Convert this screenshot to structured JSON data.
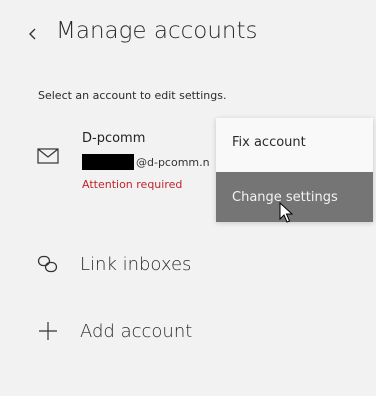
{
  "header": {
    "title": "Manage accounts",
    "back_icon": "chevron-left-icon"
  },
  "subtitle": "Select an account to edit settings.",
  "account": {
    "name": "D-pcomm",
    "email_visible": "@d-pcomm.ne",
    "status": "Attention required",
    "icon": "mail-icon",
    "status_color": "#c0252d"
  },
  "context_menu": {
    "items": [
      {
        "label": "Fix account"
      },
      {
        "label": "Change settings",
        "highlighted": true
      }
    ],
    "highlight_color": "#757575"
  },
  "nav": {
    "link_inboxes": {
      "label": "Link inboxes",
      "icon": "link-icon"
    },
    "add_account": {
      "label": "Add account",
      "icon": "plus-icon"
    }
  }
}
